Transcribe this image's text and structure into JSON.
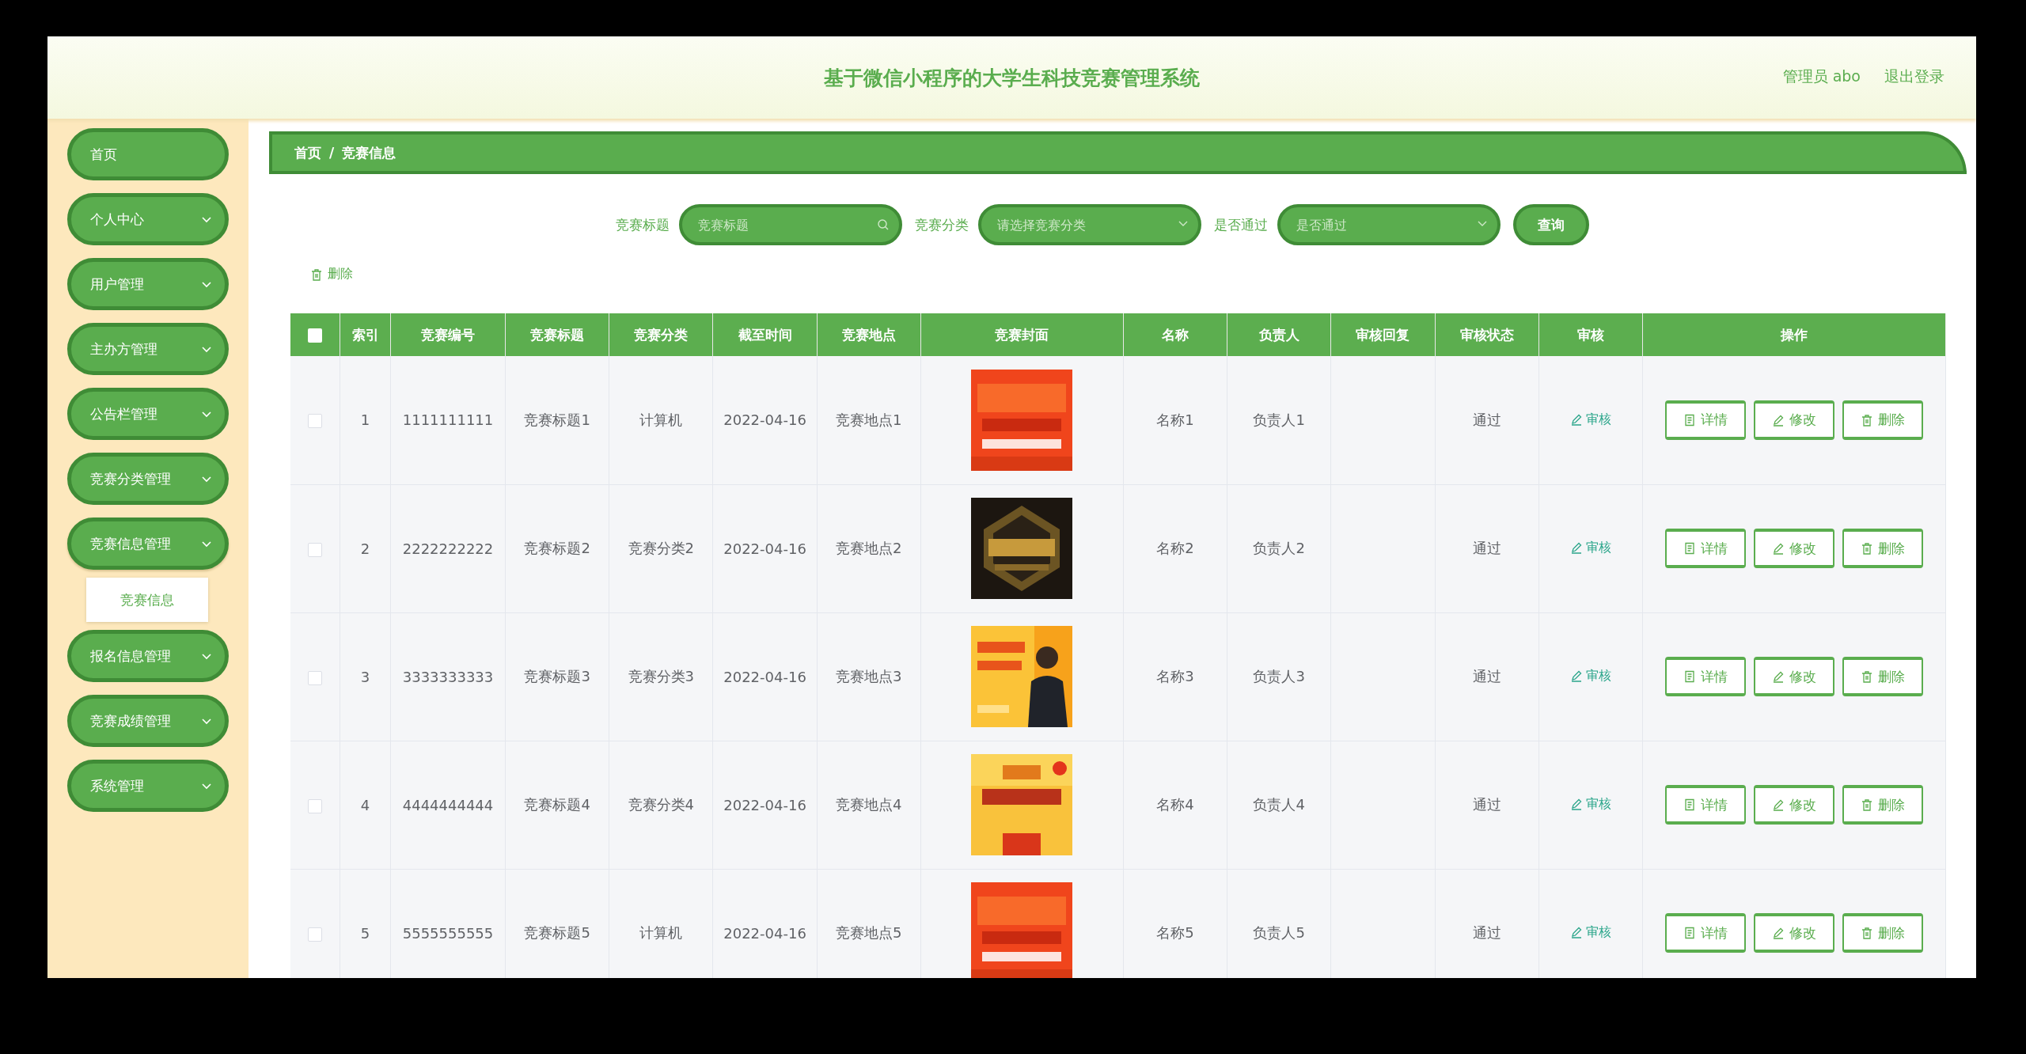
{
  "header": {
    "title": "基于微信小程序的大学生科技竞赛管理系统",
    "user": "管理员 abo",
    "logout": "退出登录"
  },
  "sidebar": {
    "items": [
      {
        "label": "首页",
        "kind": "link",
        "expanded": false
      },
      {
        "label": "个人中心",
        "kind": "menu",
        "expanded": false
      },
      {
        "label": "用户管理",
        "kind": "menu",
        "expanded": false
      },
      {
        "label": "主办方管理",
        "kind": "menu",
        "expanded": false
      },
      {
        "label": "公告栏管理",
        "kind": "menu",
        "expanded": false
      },
      {
        "label": "竞赛分类管理",
        "kind": "menu",
        "expanded": false
      },
      {
        "label": "竞赛信息管理",
        "kind": "menu",
        "expanded": true,
        "children": [
          {
            "label": "竞赛信息"
          }
        ]
      },
      {
        "label": "报名信息管理",
        "kind": "menu",
        "expanded": false
      },
      {
        "label": "竞赛成绩管理",
        "kind": "menu",
        "expanded": false
      },
      {
        "label": "系统管理",
        "kind": "menu",
        "expanded": false
      }
    ]
  },
  "breadcrumb": {
    "items": [
      "首页",
      "竞赛信息"
    ],
    "separator": "/"
  },
  "search": {
    "fields": [
      {
        "label": "竞赛标题",
        "kind": "text",
        "placeholder": "竞赛标题"
      },
      {
        "label": "竞赛分类",
        "kind": "select",
        "placeholder": "请选择竞赛分类"
      },
      {
        "label": "是否通过",
        "kind": "select",
        "placeholder": "是否通过"
      }
    ],
    "button": "查询"
  },
  "toolbar": {
    "delete": "删除"
  },
  "table": {
    "select_all_checked": false,
    "columns": [
      "索引",
      "竞赛编号",
      "竞赛标题",
      "竞赛分类",
      "截至时间",
      "竞赛地点",
      "竞赛封面",
      "名称",
      "负责人",
      "审核回复",
      "审核状态",
      "审核",
      "操作"
    ],
    "rows": [
      {
        "checked": false,
        "index": "1",
        "code": "1111111111",
        "title": "竞赛标题1",
        "category": "计算机",
        "deadline": "2022-04-16",
        "place": "竞赛地点1",
        "name": "名称1",
        "owner": "负责人1",
        "status": "通过",
        "review": "审核",
        "actions": [
          "详情",
          "修改",
          "删除"
        ]
      },
      {
        "checked": false,
        "index": "2",
        "code": "2222222222",
        "title": "竞赛标题2",
        "category": "竞赛分类2",
        "deadline": "2022-04-16",
        "place": "竞赛地点2",
        "name": "名称2",
        "owner": "负责人2",
        "status": "通过",
        "review": "审核",
        "actions": [
          "详情",
          "修改",
          "删除"
        ]
      },
      {
        "checked": false,
        "index": "3",
        "code": "3333333333",
        "title": "竞赛标题3",
        "category": "竞赛分类3",
        "deadline": "2022-04-16",
        "place": "竞赛地点3",
        "name": "名称3",
        "owner": "负责人3",
        "status": "通过",
        "review": "审核",
        "actions": [
          "详情",
          "修改",
          "删除"
        ]
      },
      {
        "checked": false,
        "index": "4",
        "code": "4444444444",
        "title": "竞赛标题4",
        "category": "竞赛分类4",
        "deadline": "2022-04-16",
        "place": "竞赛地点4",
        "name": "名称4",
        "owner": "负责人4",
        "status": "通过",
        "review": "审核",
        "actions": [
          "详情",
          "修改",
          "删除"
        ]
      },
      {
        "checked": false,
        "index": "5",
        "code": "5555555555",
        "title": "竞赛标题5",
        "category": "计算机",
        "deadline": "2022-04-16",
        "place": "竞赛地点5",
        "name": "名称5",
        "owner": "负责人5",
        "status": "通过",
        "review": "审核",
        "actions": [
          "详情",
          "修改",
          "删除"
        ]
      }
    ]
  }
}
